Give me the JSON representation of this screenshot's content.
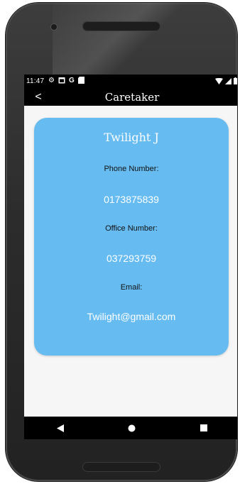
{
  "status_bar": {
    "time": "11:47",
    "icons": [
      "settings-icon",
      "calendar-icon",
      "google-icon",
      "sd-card-icon"
    ],
    "right_icons": [
      "wifi-icon",
      "signal-icon",
      "battery-icon"
    ]
  },
  "app_bar": {
    "back_label": "<",
    "title": "Caretaker"
  },
  "card": {
    "name": "Twilight J",
    "phone_label": "Phone Number:",
    "phone_value": "0173875839",
    "office_label": "Office Number:",
    "office_value": "037293759",
    "email_label": "Email:",
    "email_value": "Twilight@gmail.com",
    "background": "#66bbf0"
  },
  "nav_bar": {
    "icons": [
      "back-triangle-icon",
      "home-circle-icon",
      "recents-square-icon"
    ]
  }
}
